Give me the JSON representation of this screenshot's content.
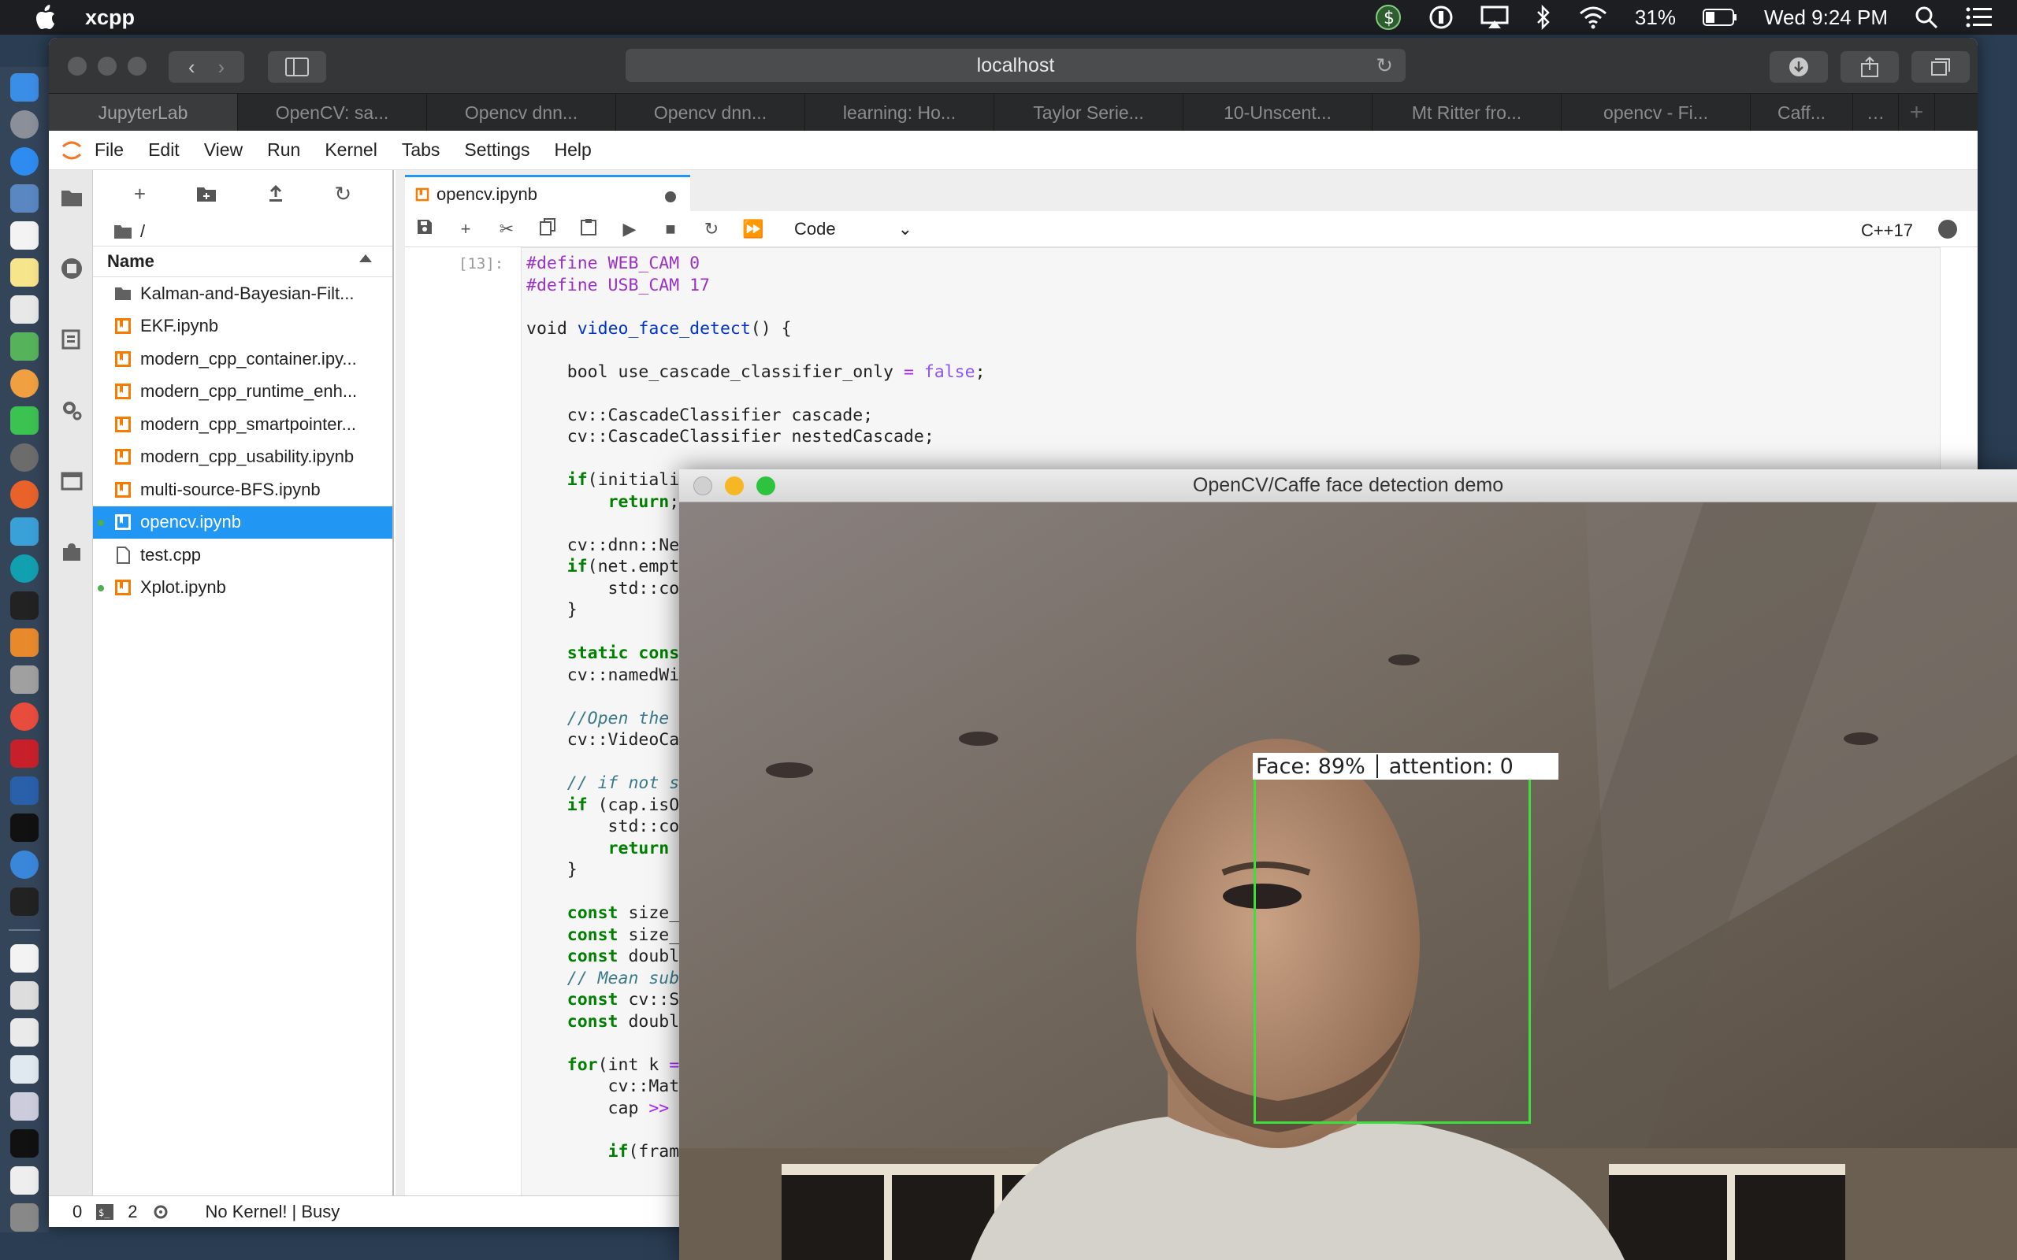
{
  "menubar": {
    "app_name": "xcpp",
    "battery": "31%",
    "clock": "Wed 9:24 PM"
  },
  "browser": {
    "url": "localhost",
    "tabs": [
      {
        "label": "JupyterLab",
        "active": true
      },
      {
        "label": "OpenCV: sa..."
      },
      {
        "label": "Opencv dnn..."
      },
      {
        "label": "Opencv dnn..."
      },
      {
        "label": "learning: Ho..."
      },
      {
        "label": "Taylor Serie..."
      },
      {
        "label": "10-Unscent..."
      },
      {
        "label": "Mt Ritter fro..."
      },
      {
        "label": "opencv - Fi..."
      },
      {
        "label": "Caff..."
      }
    ]
  },
  "jupyter": {
    "menu": [
      "File",
      "Edit",
      "View",
      "Run",
      "Kernel",
      "Tabs",
      "Settings",
      "Help"
    ],
    "filebrowser": {
      "path": "/",
      "column_header": "Name",
      "files": [
        {
          "name": "Kalman-and-Bayesian-Filt...",
          "type": "folder"
        },
        {
          "name": "EKF.ipynb",
          "type": "notebook"
        },
        {
          "name": "modern_cpp_container.ipy...",
          "type": "notebook"
        },
        {
          "name": "modern_cpp_runtime_enh...",
          "type": "notebook"
        },
        {
          "name": "modern_cpp_smartpointer...",
          "type": "notebook"
        },
        {
          "name": "modern_cpp_usability.ipynb",
          "type": "notebook"
        },
        {
          "name": "multi-source-BFS.ipynb",
          "type": "notebook"
        },
        {
          "name": "opencv.ipynb",
          "type": "notebook",
          "selected": true,
          "running": true
        },
        {
          "name": "test.cpp",
          "type": "file"
        },
        {
          "name": "Xplot.ipynb",
          "type": "notebook",
          "running": true
        }
      ]
    },
    "doc_tab": "opencv.ipynb",
    "cell_type": "Code",
    "kernel_name": "C++17",
    "cell_prompt": "[13]:",
    "status": {
      "terminals": "0",
      "kernels": "2",
      "text": "No Kernel! | Busy"
    }
  },
  "code_lines": [
    [
      {
        "t": "#define WEB_CAM 0",
        "c": "pp"
      }
    ],
    [
      {
        "t": "#define USB_CAM 17",
        "c": "pp"
      }
    ],
    [],
    [
      {
        "t": "void "
      },
      {
        "t": "video_face_detect",
        "c": "fn"
      },
      {
        "t": "() {"
      }
    ],
    [],
    [
      {
        "t": "    bool use_cascade_classifier_only "
      },
      {
        "t": "=",
        "c": "op"
      },
      {
        "t": " "
      },
      {
        "t": "false",
        "c": "bool"
      },
      {
        "t": ";"
      }
    ],
    [],
    [
      {
        "t": "    cv::CascadeClassifier cascade;"
      }
    ],
    [
      {
        "t": "    cv::CascadeClassifier nestedCascade;"
      }
    ],
    [],
    [
      {
        "t": "    "
      },
      {
        "t": "if",
        "c": "kw"
      },
      {
        "t": "(initiali"
      }
    ],
    [
      {
        "t": "        "
      },
      {
        "t": "return",
        "c": "kw"
      },
      {
        "t": ";"
      }
    ],
    [],
    [
      {
        "t": "    cv::dnn::Ne"
      }
    ],
    [
      {
        "t": "    "
      },
      {
        "t": "if",
        "c": "kw"
      },
      {
        "t": "(net.empt"
      }
    ],
    [
      {
        "t": "        std::co"
      }
    ],
    [
      {
        "t": "    }"
      }
    ],
    [],
    [
      {
        "t": "    "
      },
      {
        "t": "static cons",
        "c": "kw"
      }
    ],
    [
      {
        "t": "    cv::namedWi"
      }
    ],
    [],
    [
      {
        "t": "    "
      },
      {
        "t": "//Open the",
        "c": "cm"
      }
    ],
    [
      {
        "t": "    cv::VideoCa"
      }
    ],
    [],
    [
      {
        "t": "    "
      },
      {
        "t": "// if not s",
        "c": "cm"
      }
    ],
    [
      {
        "t": "    "
      },
      {
        "t": "if",
        "c": "kw"
      },
      {
        "t": " (cap.isO"
      }
    ],
    [
      {
        "t": "        std::co"
      }
    ],
    [
      {
        "t": "        "
      },
      {
        "t": "return",
        "c": "kw"
      }
    ],
    [
      {
        "t": "    }"
      }
    ],
    [],
    [
      {
        "t": "    "
      },
      {
        "t": "const",
        "c": "kw"
      },
      {
        "t": " size_"
      }
    ],
    [
      {
        "t": "    "
      },
      {
        "t": "const",
        "c": "kw"
      },
      {
        "t": " size_"
      }
    ],
    [
      {
        "t": "    "
      },
      {
        "t": "const",
        "c": "kw"
      },
      {
        "t": " doubl"
      }
    ],
    [
      {
        "t": "    "
      },
      {
        "t": "// Mean sub",
        "c": "cm"
      }
    ],
    [
      {
        "t": "    "
      },
      {
        "t": "const",
        "c": "kw"
      },
      {
        "t": " cv::S"
      }
    ],
    [
      {
        "t": "    "
      },
      {
        "t": "const",
        "c": "kw"
      },
      {
        "t": " doubl"
      }
    ],
    [],
    [
      {
        "t": "    "
      },
      {
        "t": "for",
        "c": "kw"
      },
      {
        "t": "(int k "
      },
      {
        "t": "=",
        "c": "op"
      }
    ],
    [
      {
        "t": "        cv::Mat"
      }
    ],
    [
      {
        "t": "        cap "
      },
      {
        "t": ">>",
        "c": "op"
      }
    ],
    [],
    [
      {
        "t": "        "
      },
      {
        "t": "if",
        "c": "kw"
      },
      {
        "t": "(fram"
      }
    ]
  ],
  "cv_window": {
    "title": "OpenCV/Caffe face detection demo",
    "face_label": "Face: 89%",
    "attention_label": "attention: 0",
    "box_color": "#3be03b"
  }
}
